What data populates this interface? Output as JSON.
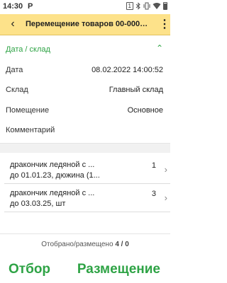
{
  "status_bar": {
    "time": "14:30",
    "notification": "P",
    "sim": "1",
    "icons": [
      "sim-icon",
      "bluetooth-icon",
      "vibrate-icon",
      "wifi-icon",
      "battery-icon"
    ]
  },
  "appbar": {
    "title": "Перемещение товаров 00-000…",
    "back_icon": "‹",
    "menu_icon": "⋮"
  },
  "section": {
    "title": "Дата / склад",
    "collapse_icon": "⌃"
  },
  "fields": [
    {
      "label": "Дата",
      "value": "08.02.2022 14:00:52"
    },
    {
      "label": "Склад",
      "value": "Главный склад"
    },
    {
      "label": "Помещение",
      "value": "Основное"
    },
    {
      "label": "Комментарий",
      "value": ""
    }
  ],
  "items": [
    {
      "line1": "дракончик ледяной с ...",
      "line2": "до 01.01.23, дюжина (1...",
      "qty": "1"
    },
    {
      "line1": "дракончик ледяной с ...",
      "line2": "до 03.03.25, шт",
      "qty": "3"
    }
  ],
  "footer": {
    "counter_label": "Отобрано/размещено",
    "counter_value": "4 / 0",
    "pick_button": "Отбор",
    "place_button": "Размещение"
  },
  "colors": {
    "accent": "#2ea345",
    "appbar": "#fde28a"
  }
}
